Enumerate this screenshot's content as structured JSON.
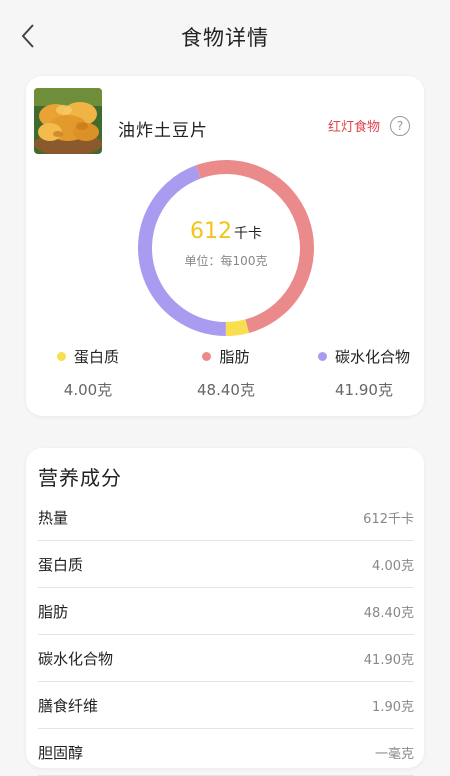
{
  "header": {
    "title": "食物详情"
  },
  "food": {
    "name": "油炸土豆片",
    "tag": "红灯食物",
    "tag_color": "#e0444e",
    "image_icon": "potato-chips-photo"
  },
  "energy": {
    "value": "612",
    "unit": "千卡",
    "note": "单位：每100克"
  },
  "chart_data": {
    "type": "pie",
    "categories": [
      "蛋白质",
      "脂肪",
      "碳水化合物"
    ],
    "values": [
      4.0,
      48.4,
      41.9
    ],
    "colors": [
      "#f7df4f",
      "#eb8a8a",
      "#a99cf0"
    ]
  },
  "macros": [
    {
      "label": "蛋白质",
      "value": "4.00克",
      "color": "#f7df4f"
    },
    {
      "label": "脂肪",
      "value": "48.40克",
      "color": "#eb8a8a"
    },
    {
      "label": "碳水化合物",
      "value": "41.90克",
      "color": "#a99cf0"
    }
  ],
  "nutrition": {
    "title": "营养成分",
    "rows": [
      {
        "label": "热量",
        "value": "612千卡"
      },
      {
        "label": "蛋白质",
        "value": "4.00克"
      },
      {
        "label": "脂肪",
        "value": "48.40克"
      },
      {
        "label": "碳水化合物",
        "value": "41.90克"
      },
      {
        "label": "膳食纤维",
        "value": "1.90克"
      },
      {
        "label": "胆固醇",
        "value": "一毫克"
      }
    ]
  }
}
